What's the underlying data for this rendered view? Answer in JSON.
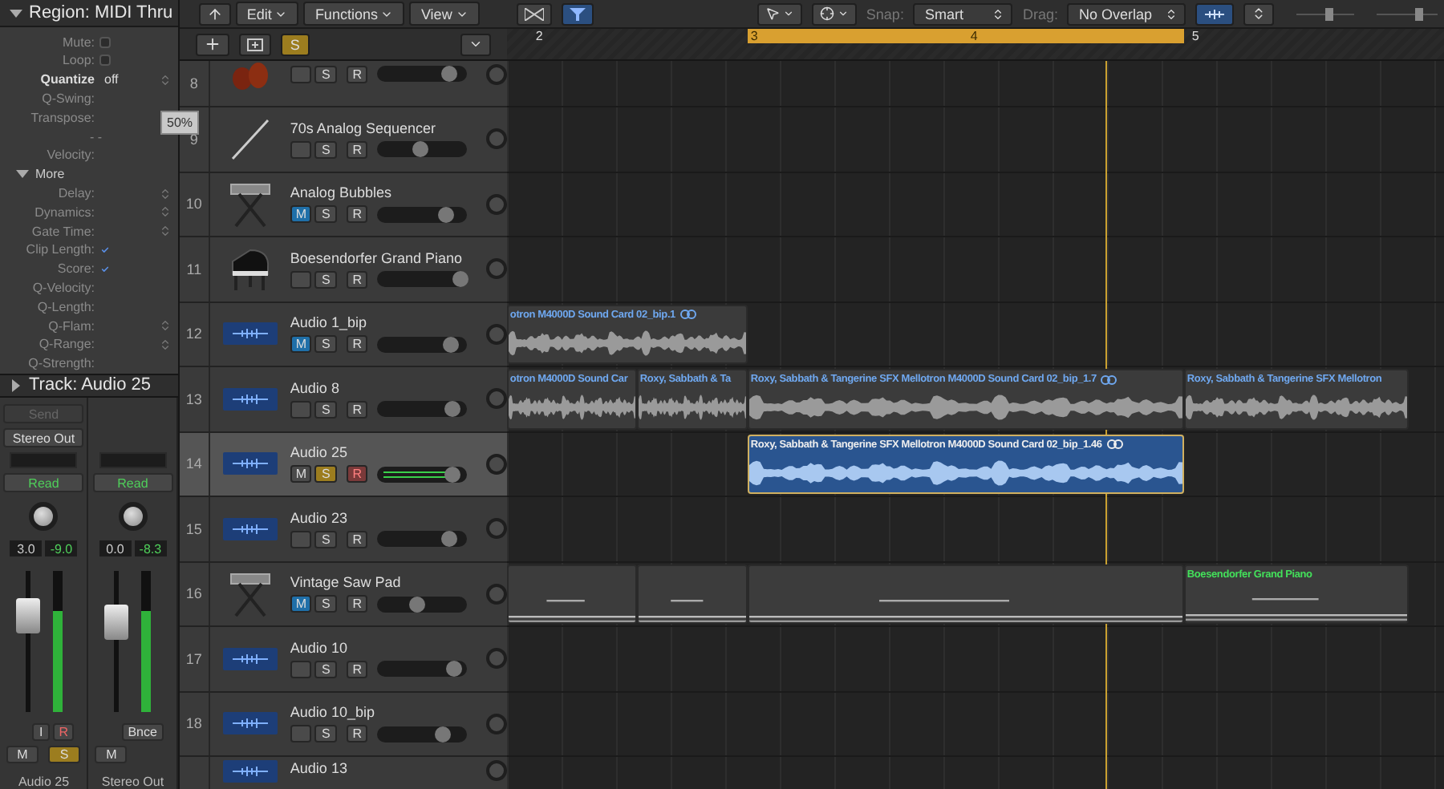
{
  "inspector": {
    "region_header": {
      "title": "Region: MIDI Thru",
      "expanded": true
    },
    "params": [
      {
        "kind": "checkbox",
        "label": "Mute:",
        "checked": false
      },
      {
        "kind": "checkbox",
        "label": "Loop:",
        "checked": false
      },
      {
        "kind": "popup",
        "label": "Quantize",
        "value": "off"
      },
      {
        "kind": "plain",
        "label": "Q-Swing:"
      },
      {
        "kind": "stepper",
        "label": "Transpose:",
        "tooltip": "50%"
      },
      {
        "kind": "dashes",
        "label": "- -"
      },
      {
        "kind": "plain",
        "label": "Velocity:"
      },
      {
        "kind": "group",
        "label": "More",
        "expanded": true
      },
      {
        "kind": "stepper",
        "label": "Delay:"
      },
      {
        "kind": "stepper",
        "label": "Dynamics:"
      },
      {
        "kind": "stepper",
        "label": "Gate Time:"
      },
      {
        "kind": "checkbox",
        "label": "Clip Length:",
        "checked": true
      },
      {
        "kind": "checkbox",
        "label": "Score:",
        "checked": true
      },
      {
        "kind": "plain",
        "label": "Q-Velocity:"
      },
      {
        "kind": "plain",
        "label": "Q-Length:"
      },
      {
        "kind": "stepper",
        "label": "Q-Flam:"
      },
      {
        "kind": "stepper",
        "label": "Q-Range:"
      },
      {
        "kind": "plain",
        "label": "Q-Strength:"
      }
    ],
    "track_header": {
      "title": "Track: Audio 25",
      "expanded": false
    }
  },
  "channel_strips": [
    {
      "send": "Send",
      "output": "Stereo Out",
      "automation": "Read",
      "value_1": "3.0",
      "value_2": "-9.0",
      "level": 0.75,
      "buttons": [
        {
          "label": "I",
          "kind": "input"
        },
        {
          "label": "R",
          "kind": "record"
        }
      ],
      "mute": "M",
      "solo": "S",
      "solo_on": true,
      "name": "Audio 25"
    },
    {
      "automation": "Read",
      "value_1": "0.0",
      "value_2": "-8.3",
      "level": 0.68,
      "buttons": [
        {
          "label": "Bnce",
          "kind": "bounce"
        }
      ],
      "mute": "M",
      "name": "Stereo Out"
    }
  ],
  "track_toolbar": {
    "menus": [
      "Edit",
      "Functions",
      "View"
    ],
    "solo_button": {
      "label": "S",
      "on": true
    }
  },
  "arrange_toolbar": {
    "snap": {
      "label": "Snap:",
      "value": "Smart"
    },
    "drag": {
      "label": "Drag:",
      "value": "No Overlap"
    }
  },
  "ruler": {
    "bars": [
      "2",
      "3",
      "4",
      "5"
    ],
    "cycle_on": true
  },
  "tracks": [
    {
      "number": "8",
      "kind": "strings",
      "muted": false,
      "solo_label": "S",
      "solo": false,
      "rec_label": "R",
      "record": false,
      "level": 0.82,
      "selected": false
    },
    {
      "number": "9",
      "name": "70s Analog Sequencer",
      "kind": "stick",
      "muted": false,
      "solo_label": "S",
      "solo": false,
      "rec_label": "R",
      "record": false,
      "level": 0.45,
      "selected": false
    },
    {
      "number": "10",
      "name": "Analog Bubbles",
      "kind": "synth",
      "m_label": "M",
      "muted": true,
      "solo_label": "S",
      "solo": false,
      "rec_label": "R",
      "record": false,
      "level": 0.78,
      "selected": false
    },
    {
      "number": "11",
      "name": "Boesendorfer Grand Piano",
      "kind": "piano",
      "muted": false,
      "solo_label": "S",
      "solo": false,
      "rec_label": "R",
      "record": false,
      "level": 0.97,
      "selected": false
    },
    {
      "number": "12",
      "name": "Audio 1_bip",
      "kind": "audio",
      "m_label": "M",
      "muted": true,
      "solo_label": "S",
      "solo": false,
      "rec_label": "R",
      "record": false,
      "level": 0.84,
      "selected": false,
      "regions": [
        {
          "kind": "audio",
          "name": "otron M4000D Sound Card 02_bip.1",
          "linked": true,
          "selected": false
        }
      ]
    },
    {
      "number": "13",
      "name": "Audio 8",
      "kind": "audio",
      "muted": false,
      "solo_label": "S",
      "solo": false,
      "rec_label": "R",
      "record": false,
      "level": 0.86,
      "selected": false,
      "regions": [
        {
          "kind": "audio",
          "name": "otron M4000D Sound Car",
          "linked": false,
          "selected": false
        },
        {
          "kind": "audio",
          "name": "Roxy, Sabbath & Ta",
          "linked": false,
          "selected": false
        },
        {
          "kind": "audio",
          "name": "Roxy, Sabbath & Tangerine SFX Mellotron M4000D Sound Card 02_bip_1.7",
          "linked": true,
          "selected": false
        },
        {
          "kind": "audio",
          "name": "Roxy, Sabbath & Tangerine SFX Mellotron",
          "linked": false,
          "selected": false
        }
      ]
    },
    {
      "number": "14",
      "name": "Audio 25",
      "kind": "audio",
      "m_label": "M",
      "muted": false,
      "solo_label": "S",
      "solo": true,
      "rec_label": "R",
      "record": true,
      "level": 0.86,
      "selected": true,
      "regions": [
        {
          "kind": "audio",
          "name": "Roxy, Sabbath & Tangerine SFX Mellotron M4000D Sound Card 02_bip_1.46",
          "linked": true,
          "selected": true
        }
      ]
    },
    {
      "number": "15",
      "name": "Audio 23",
      "kind": "audio",
      "muted": false,
      "solo_label": "S",
      "solo": false,
      "rec_label": "R",
      "record": false,
      "level": 0.83,
      "selected": false
    },
    {
      "number": "16",
      "name": "Vintage Saw Pad",
      "kind": "synth",
      "m_label": "M",
      "muted": true,
      "solo_label": "S",
      "solo": false,
      "rec_label": "R",
      "record": false,
      "level": 0.4,
      "selected": false,
      "regions": [
        {
          "kind": "midi",
          "selected": false
        },
        {
          "kind": "midi",
          "selected": false
        },
        {
          "kind": "midi",
          "selected": false
        },
        {
          "kind": "midi",
          "name": "Boesendorfer Grand Piano",
          "selected": false
        }
      ]
    },
    {
      "number": "17",
      "name": "Audio 10",
      "kind": "audio",
      "muted": false,
      "solo_label": "S",
      "solo": false,
      "rec_label": "R",
      "record": false,
      "level": 0.88,
      "selected": false
    },
    {
      "number": "18",
      "name": "Audio 10_bip",
      "kind": "audio",
      "muted": false,
      "solo_label": "S",
      "solo": false,
      "rec_label": "R",
      "record": false,
      "level": 0.74,
      "selected": false
    },
    {
      "name": "Audio 13",
      "kind": "audio",
      "selected": false
    }
  ]
}
